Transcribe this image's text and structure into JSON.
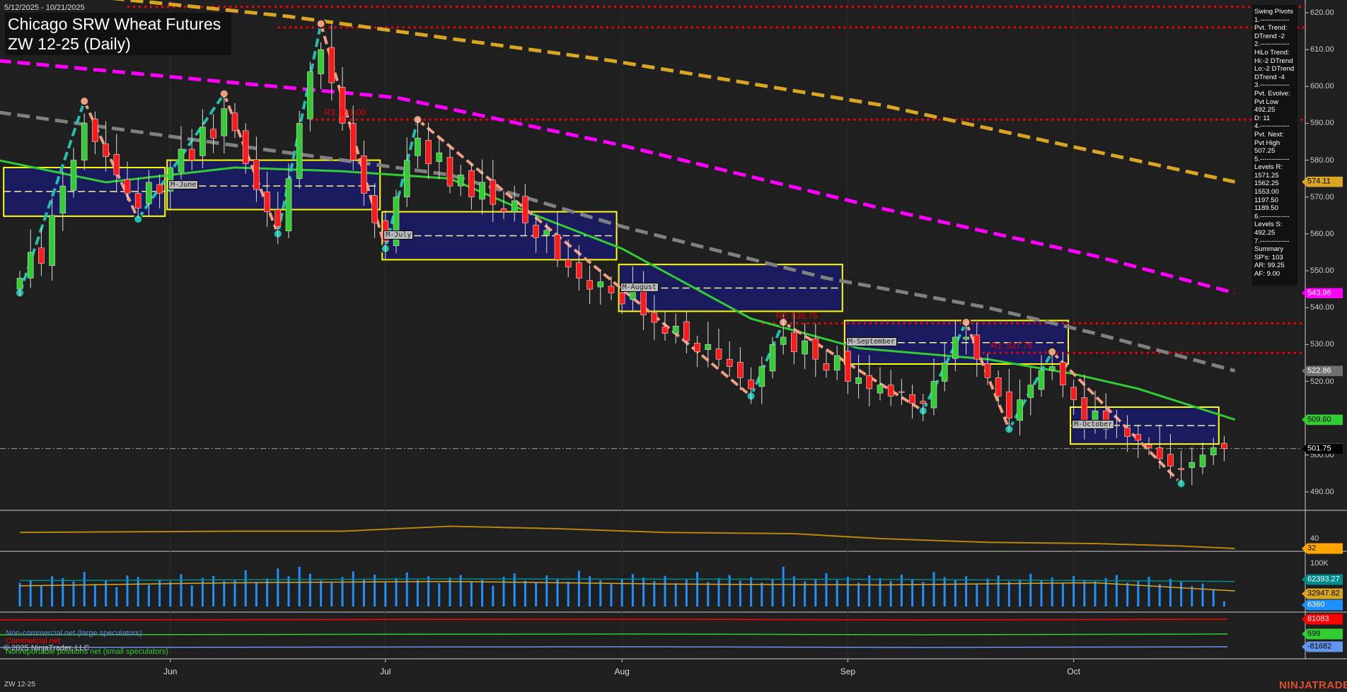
{
  "header": {
    "date_range": "5/12/2025 - 10/21/2025",
    "title": "Chicago SRW Wheat Futures",
    "subtitle": "ZW 12-25 (Daily)"
  },
  "legend": {
    "lines": [
      "Swing Pivots",
      "1.-------------",
      "Pvt. Trend:",
      "DTrend -2",
      "2.-------------",
      "HiLo Trend:",
      "Hi:-2 DTrend",
      "Lo:-2 DTrend",
      "DTrend -4",
      "3.-------------",
      "Pvt. Evolve:",
      "Pvt Low",
      "492.25",
      "D: 11",
      "4.-------------",
      "Pvt. Next:",
      "Pvt High",
      "507.25",
      "5.-------------",
      "Levels R:",
      "1571.25",
      "1562.25",
      "1553.00",
      "1197.50",
      "1189.50",
      "6.-------------",
      "Levels S:",
      "492.25",
      "7.-------------",
      "Summary",
      "SP's: 103",
      "AR: 99.25",
      "AF: 9.00"
    ]
  },
  "footer": {
    "symbol": "ZW 12-25",
    "logo": "NINJATRADER",
    "copyright": "© 2025 NinjaTrader, LLC"
  },
  "cot_legend": {
    "noncommercial": "Non-commercial net (large speculators)",
    "commercial": "Commercial net",
    "nonreportable": "Nonreportable positions net (small speculators)"
  },
  "colors": {
    "up": "#32cd32",
    "down": "#ff1a1a",
    "ma20": "#32cd32",
    "ma_gray": "#808080",
    "ma_magenta": "#ff00ff",
    "ma_orange": "#daa520",
    "level": "#ff0000",
    "box_fill": "#1a1a5e",
    "box_border": "#ffff00",
    "volume": "#1e90ff"
  },
  "chart_data": {
    "type": "candlestick",
    "price_axis": {
      "ticks": [
        "620.00",
        "610.00",
        "600.00",
        "590.00",
        "580.00",
        "570.00",
        "560.00",
        "550.00",
        "540.00",
        "530.00",
        "520.00",
        "510.00",
        "500.00",
        "490.00"
      ],
      "range": [
        487,
        623
      ]
    },
    "months": [
      {
        "label": "Jun",
        "bar": 14
      },
      {
        "label": "Jul",
        "bar": 34
      },
      {
        "label": "Aug",
        "bar": 56
      },
      {
        "label": "Sep",
        "bar": 77
      },
      {
        "label": "Oct",
        "bar": 98
      }
    ],
    "closes": [
      548,
      555,
      552,
      565,
      573,
      580,
      590,
      585,
      581,
      576,
      571,
      567,
      574,
      571,
      578,
      583,
      580,
      589,
      586,
      594,
      588,
      579,
      572,
      566,
      562,
      575,
      590,
      604,
      610,
      601,
      590,
      580,
      571,
      563,
      558,
      570,
      580,
      586,
      579,
      582,
      573,
      576,
      570,
      574,
      568,
      566,
      569,
      563,
      559,
      561,
      553,
      551,
      548,
      545,
      547,
      544,
      541,
      545,
      538,
      536,
      533,
      535,
      531,
      528,
      530,
      526,
      524,
      521,
      518,
      524,
      530,
      532,
      528,
      531,
      526,
      523,
      527,
      520,
      521,
      518,
      519,
      516,
      517,
      514,
      514,
      520,
      525,
      532,
      532,
      526,
      521,
      516,
      510,
      515,
      519,
      523,
      524,
      519,
      515,
      509,
      512,
      507,
      508,
      505,
      504,
      502,
      499,
      497,
      496,
      498,
      500,
      502,
      501.75
    ],
    "volume_k": [
      55,
      62,
      48,
      70,
      66,
      58,
      80,
      52,
      60,
      45,
      72,
      68,
      50,
      63,
      58,
      75,
      49,
      66,
      71,
      59,
      62,
      84,
      57,
      65,
      88,
      70,
      92,
      76,
      60,
      55,
      68,
      81,
      63,
      74,
      58,
      66,
      79,
      61,
      70,
      54,
      67,
      73,
      59,
      62,
      48,
      69,
      77,
      60,
      56,
      72,
      65,
      58,
      83,
      70,
      61,
      52,
      64,
      75,
      67,
      59,
      71,
      54,
      62,
      80,
      57,
      66,
      73,
      60,
      68,
      55,
      63,
      92,
      70,
      58,
      64,
      77,
      61,
      69,
      55,
      72,
      66,
      59,
      74,
      62,
      57,
      80,
      68,
      61,
      70,
      53,
      65,
      72,
      58,
      63,
      76,
      60,
      67,
      54,
      71,
      62,
      58,
      66,
      73,
      55,
      60,
      69,
      52,
      64,
      58,
      47,
      53,
      40,
      12
    ],
    "volume_axis": {
      "tick": "100K"
    },
    "ma_lines": [
      {
        "name": "ma-green",
        "color": "#32cd32",
        "dash": false,
        "points": [
          [
            -2,
            580
          ],
          [
            8,
            574
          ],
          [
            20,
            578
          ],
          [
            30,
            577
          ],
          [
            40,
            575
          ],
          [
            48,
            565
          ],
          [
            56,
            556
          ],
          [
            68,
            537
          ],
          [
            78,
            529
          ],
          [
            90,
            526
          ],
          [
            98,
            522
          ],
          [
            104,
            518
          ],
          [
            113,
            509.6
          ]
        ]
      },
      {
        "name": "ma-gray",
        "color": "#808080",
        "dash": true,
        "points": [
          [
            -2,
            593
          ],
          [
            20,
            584
          ],
          [
            40,
            576
          ],
          [
            56,
            562
          ],
          [
            75,
            548
          ],
          [
            90,
            540
          ],
          [
            100,
            533
          ],
          [
            113,
            522.86
          ]
        ]
      },
      {
        "name": "ma-magenta",
        "color": "#ff00ff",
        "dash": true,
        "points": [
          [
            -2,
            607
          ],
          [
            20,
            601
          ],
          [
            35,
            597
          ],
          [
            56,
            584
          ],
          [
            80,
            567
          ],
          [
            100,
            554
          ],
          [
            113,
            543.96
          ]
        ]
      },
      {
        "name": "ma-orange",
        "color": "#daa520",
        "dash": true,
        "points": [
          [
            5,
            625
          ],
          [
            25,
            619
          ],
          [
            55,
            607
          ],
          [
            80,
            595
          ],
          [
            113,
            574.11
          ]
        ]
      }
    ],
    "levels": [
      {
        "label": "",
        "value": 621.6,
        "from": 10
      },
      {
        "label": "",
        "value": 616,
        "from": 24
      },
      {
        "label": "R3: 591.00",
        "value": 591,
        "from": 27
      },
      {
        "label": "R2: 535.75",
        "value": 535.75,
        "from": 69
      },
      {
        "label": "R1: 527.75",
        "value": 527.75,
        "from": 89
      }
    ],
    "month_boxes": [
      {
        "label": "",
        "from": -1.5,
        "to": 13.5,
        "high": 578,
        "low": 564.8,
        "mid": 571.5
      },
      {
        "label": "M-June",
        "from": 13.7,
        "to": 33.5,
        "high": 580,
        "low": 566.6,
        "mid": 573
      },
      {
        "label": "M-July",
        "from": 33.7,
        "to": 55.5,
        "high": 566,
        "low": 553,
        "mid": 559.5
      },
      {
        "label": "M-August",
        "from": 55.7,
        "to": 76.5,
        "high": 551.7,
        "low": 539,
        "mid": 545.3
      },
      {
        "label": "M-September",
        "from": 76.7,
        "to": 97.5,
        "high": 536.5,
        "low": 524.7,
        "mid": 530.5
      },
      {
        "label": "M-October",
        "from": 97.7,
        "to": 111.5,
        "high": 513,
        "low": 503,
        "mid": 508
      }
    ],
    "swing_pivots": [
      [
        0,
        544,
        "low"
      ],
      [
        6,
        596,
        "high"
      ],
      [
        11,
        564,
        "low"
      ],
      [
        19,
        598,
        "high"
      ],
      [
        24,
        560,
        "low"
      ],
      [
        28,
        617,
        "high"
      ],
      [
        34,
        556,
        "low"
      ],
      [
        37,
        591,
        "high"
      ],
      [
        68,
        516,
        "low"
      ],
      [
        71,
        536,
        "high"
      ],
      [
        84,
        512,
        "low"
      ],
      [
        88,
        536,
        "high"
      ],
      [
        92,
        507,
        "low"
      ],
      [
        96,
        528,
        "high"
      ],
      [
        108,
        492.25,
        "low"
      ]
    ],
    "last_price": 501.75,
    "price_tags": [
      {
        "value": 574.11,
        "label": "574.11",
        "bg": "#daa520",
        "fg": "#000"
      },
      {
        "value": 543.96,
        "label": "543.96",
        "bg": "#ff00ff",
        "fg": "#fff"
      },
      {
        "value": 522.86,
        "label": "522.86",
        "bg": "#707070",
        "fg": "#fff"
      },
      {
        "value": 509.6,
        "label": "509.60",
        "bg": "#32cd32",
        "fg": "#000"
      },
      {
        "value": 501.75,
        "label": "501.75",
        "bg": "#000",
        "fg": "#fff"
      }
    ],
    "osc_panel": {
      "tick": "40",
      "last": "32",
      "points": [
        [
          0,
          45
        ],
        [
          20,
          46
        ],
        [
          30,
          46
        ],
        [
          40,
          50
        ],
        [
          50,
          48
        ],
        [
          60,
          45
        ],
        [
          72,
          44
        ],
        [
          80,
          40
        ],
        [
          90,
          37
        ],
        [
          100,
          36
        ],
        [
          108,
          34
        ],
        [
          113,
          32
        ]
      ]
    },
    "volume_tags": [
      {
        "label": "62393.27",
        "bg": "#008b8b",
        "fg": "#fff"
      },
      {
        "label": "32947.82",
        "bg": "#daa520",
        "fg": "#000"
      },
      {
        "label": "6360",
        "bg": "#1e90ff",
        "fg": "#fff"
      }
    ],
    "cot_tags": [
      {
        "label": "81083",
        "bg": "#ff0000",
        "fg": "#fff"
      },
      {
        "label": "599",
        "bg": "#32cd32",
        "fg": "#000"
      },
      {
        "label": "-81682",
        "bg": "#6495ed",
        "fg": "#000"
      }
    ]
  }
}
